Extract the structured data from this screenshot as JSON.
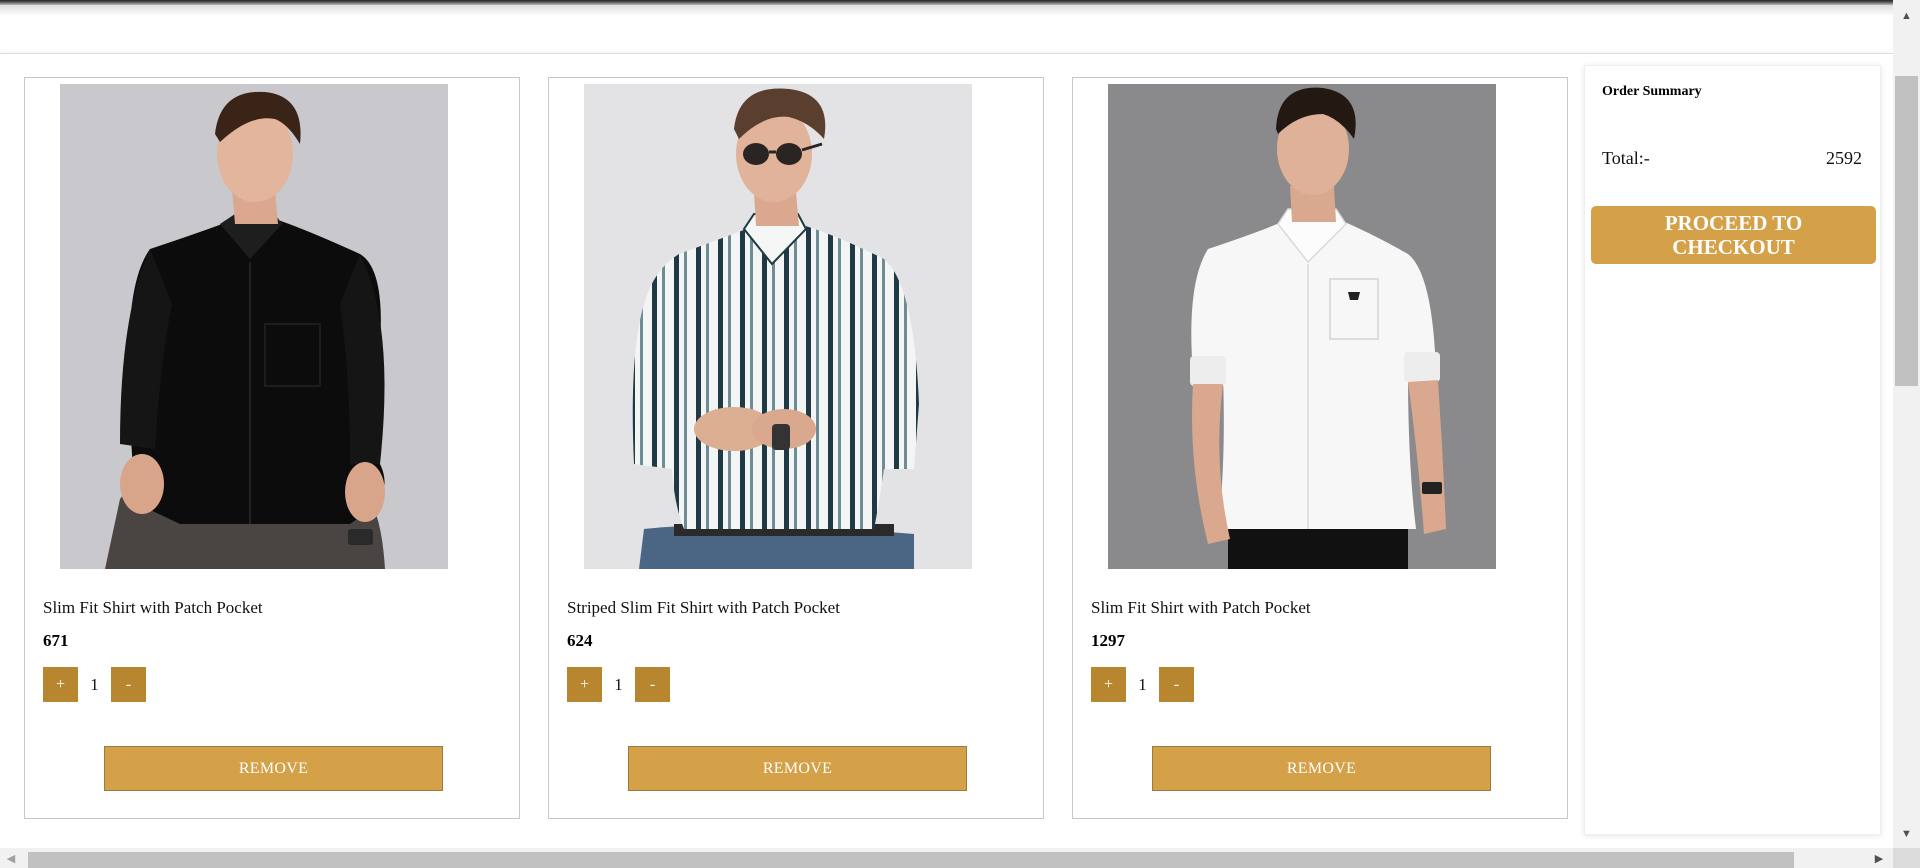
{
  "cart": {
    "items": [
      {
        "name": "Slim Fit Shirt with Patch Pocket",
        "price": "671",
        "quantity": "1",
        "plus_label": "+",
        "minus_label": "-",
        "remove_label": "REMOVE",
        "shirt_color": "#0c0c0c",
        "background_color": "#c9c9cd"
      },
      {
        "name": "Striped Slim Fit Shirt with Patch Pocket",
        "price": "624",
        "quantity": "1",
        "plus_label": "+",
        "minus_label": "-",
        "remove_label": "REMOVE",
        "shirt_color": "#f4f6f5",
        "background_color": "#e3e2e5"
      },
      {
        "name": "Slim Fit Shirt with Patch Pocket",
        "price": "1297",
        "quantity": "1",
        "plus_label": "+",
        "minus_label": "-",
        "remove_label": "REMOVE",
        "shirt_color": "#f7f7f7",
        "background_color": "#8a898c"
      }
    ]
  },
  "summary": {
    "title": "Order Summary",
    "total_label": "Total:-",
    "total_value": "2592",
    "checkout_label": "PROCEED TO CHECKOUT"
  },
  "colors": {
    "accent": "#d4a048",
    "qty_button": "#b8862f"
  },
  "scrollbars": {
    "up_icon": "▲",
    "down_icon": "▼",
    "left_icon": "◀",
    "right_icon": "▶"
  }
}
